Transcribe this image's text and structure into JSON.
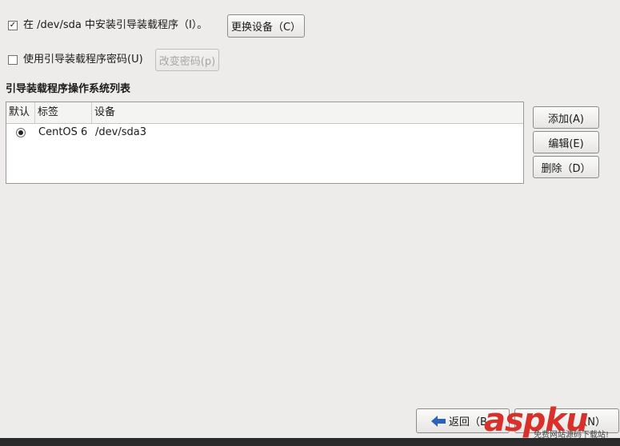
{
  "install_bootloader": {
    "checked": true,
    "check_mark": "✓",
    "label": "在 /dev/sda 中安装引导装载程序（I）。",
    "change_device_button": "更换设备（C）"
  },
  "bootloader_password": {
    "checked": false,
    "label": "使用引导装载程序密码(U)",
    "change_password_button": "改变密码(p)"
  },
  "os_list": {
    "title": "引导装载程序操作系统列表",
    "columns": [
      "默认",
      "标签",
      "设备"
    ],
    "rows": [
      {
        "default": true,
        "label": "CentOS 6",
        "device": "/dev/sda3"
      }
    ]
  },
  "side_buttons": {
    "add": "添加(A)",
    "edit": "编辑(E)",
    "delete": "删除（D）"
  },
  "navigation": {
    "back": "返回（B",
    "next": "（N）"
  },
  "watermark": {
    "brand": "aspku",
    "tagline": "免费网站源码下载站!"
  }
}
